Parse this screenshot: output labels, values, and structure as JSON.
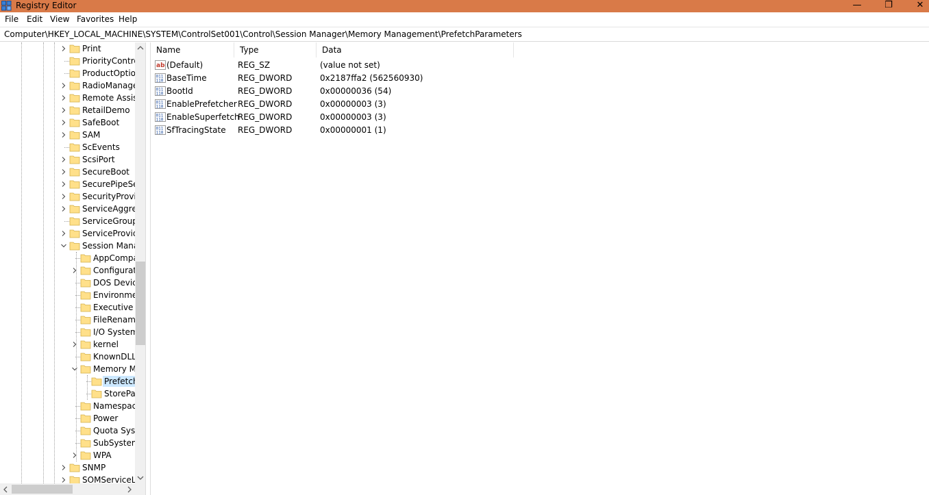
{
  "window": {
    "title": "Registry Editor",
    "minimize_glyph": "—",
    "maximize_glyph": "❐",
    "close_glyph": "✕"
  },
  "menu": [
    "File",
    "Edit",
    "View",
    "Favorites",
    "Help"
  ],
  "address": "Computer\\HKEY_LOCAL_MACHINE\\SYSTEM\\ControlSet001\\Control\\Session Manager\\Memory Management\\PrefetchParameters",
  "tree": {
    "items": [
      {
        "label": "Print",
        "level": 1,
        "expander": "collapsed"
      },
      {
        "label": "PriorityContro",
        "level": 1,
        "expander": "none"
      },
      {
        "label": "ProductOptior",
        "level": 1,
        "expander": "none"
      },
      {
        "label": "RadioManage",
        "level": 1,
        "expander": "collapsed"
      },
      {
        "label": "Remote Assist",
        "level": 1,
        "expander": "collapsed"
      },
      {
        "label": "RetailDemo",
        "level": 1,
        "expander": "collapsed"
      },
      {
        "label": "SafeBoot",
        "level": 1,
        "expander": "collapsed"
      },
      {
        "label": "SAM",
        "level": 1,
        "expander": "collapsed"
      },
      {
        "label": "ScEvents",
        "level": 1,
        "expander": "none"
      },
      {
        "label": "ScsiPort",
        "level": 1,
        "expander": "collapsed"
      },
      {
        "label": "SecureBoot",
        "level": 1,
        "expander": "collapsed"
      },
      {
        "label": "SecurePipeSer",
        "level": 1,
        "expander": "collapsed"
      },
      {
        "label": "SecurityProvic",
        "level": 1,
        "expander": "collapsed"
      },
      {
        "label": "ServiceAggreg",
        "level": 1,
        "expander": "collapsed"
      },
      {
        "label": "ServiceGroupC",
        "level": 1,
        "expander": "none"
      },
      {
        "label": "ServiceProvide",
        "level": 1,
        "expander": "collapsed"
      },
      {
        "label": "Session Manag",
        "level": 1,
        "expander": "expanded"
      },
      {
        "label": "AppCompa",
        "level": 2,
        "expander": "none"
      },
      {
        "label": "Configurat",
        "level": 2,
        "expander": "collapsed"
      },
      {
        "label": "DOS Device",
        "level": 2,
        "expander": "none"
      },
      {
        "label": "Environme",
        "level": 2,
        "expander": "none"
      },
      {
        "label": "Executive",
        "level": 2,
        "expander": "none"
      },
      {
        "label": "FileRename",
        "level": 2,
        "expander": "none"
      },
      {
        "label": "I/O System",
        "level": 2,
        "expander": "none"
      },
      {
        "label": "kernel",
        "level": 2,
        "expander": "collapsed"
      },
      {
        "label": "KnownDLL",
        "level": 2,
        "expander": "none"
      },
      {
        "label": "Memory M",
        "level": 2,
        "expander": "expanded"
      },
      {
        "label": "Prefetch",
        "level": 3,
        "expander": "none",
        "selected": true
      },
      {
        "label": "StorePar",
        "level": 3,
        "expander": "none"
      },
      {
        "label": "Namespac",
        "level": 2,
        "expander": "none"
      },
      {
        "label": "Power",
        "level": 2,
        "expander": "none"
      },
      {
        "label": "Quota Syst",
        "level": 2,
        "expander": "none"
      },
      {
        "label": "SubSystem",
        "level": 2,
        "expander": "none"
      },
      {
        "label": "WPA",
        "level": 2,
        "expander": "collapsed"
      },
      {
        "label": "SNMP",
        "level": 1,
        "expander": "collapsed"
      },
      {
        "label": "SOMServiceLis",
        "level": 1,
        "expander": "collapsed"
      }
    ]
  },
  "values": {
    "columns": [
      "Name",
      "Type",
      "Data"
    ],
    "rows": [
      {
        "name": "(Default)",
        "type": "REG_SZ",
        "data": "(value not set)",
        "icon": "string-value-icon"
      },
      {
        "name": "BaseTime",
        "type": "REG_DWORD",
        "data": "0x2187ffa2 (562560930)",
        "icon": "dword-value-icon"
      },
      {
        "name": "BootId",
        "type": "REG_DWORD",
        "data": "0x00000036 (54)",
        "icon": "dword-value-icon"
      },
      {
        "name": "EnablePrefetcher",
        "type": "REG_DWORD",
        "data": "0x00000003 (3)",
        "icon": "dword-value-icon"
      },
      {
        "name": "EnableSuperfetch",
        "type": "REG_DWORD",
        "data": "0x00000003 (3)",
        "icon": "dword-value-icon"
      },
      {
        "name": "SfTracingState",
        "type": "REG_DWORD",
        "data": "0x00000001 (1)",
        "icon": "dword-value-icon"
      }
    ]
  },
  "colors": {
    "titlebar": "#d97a48",
    "selection": "#cce8ff",
    "folder": "#ffe08a"
  }
}
